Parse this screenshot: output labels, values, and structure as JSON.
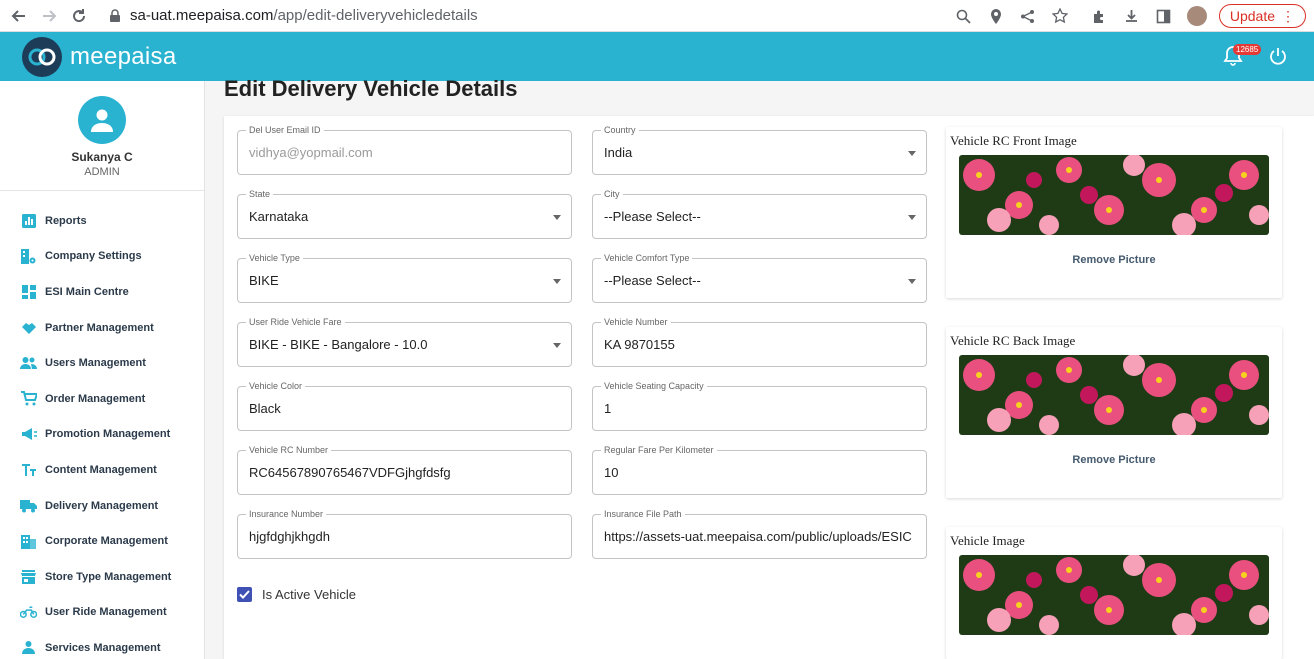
{
  "browser": {
    "url_host": "sa-uat.meepaisa.com",
    "url_path": "/app/edit-deliveryvehicledetails",
    "update_label": "Update"
  },
  "app": {
    "brand": "meepaisa",
    "notification_count": "12685"
  },
  "user": {
    "name": "Sukanya C",
    "role": "ADMIN"
  },
  "sidebar": {
    "items": [
      {
        "label": "Reports",
        "icon": "bar-chart-icon"
      },
      {
        "label": "Company Settings",
        "icon": "company-settings-icon"
      },
      {
        "label": "ESI Main Centre",
        "icon": "dashboard-icon"
      },
      {
        "label": "Partner Management",
        "icon": "handshake-icon"
      },
      {
        "label": "Users Management",
        "icon": "people-icon"
      },
      {
        "label": "Order Management",
        "icon": "cart-icon"
      },
      {
        "label": "Promotion Management",
        "icon": "megaphone-icon"
      },
      {
        "label": "Content Management",
        "icon": "text-fields-icon"
      },
      {
        "label": "Delivery Management",
        "icon": "truck-icon"
      },
      {
        "label": "Corporate Management",
        "icon": "building-icon"
      },
      {
        "label": "Store Type Management",
        "icon": "store-icon"
      },
      {
        "label": "User Ride Management",
        "icon": "motorcycle-icon"
      },
      {
        "label": "Services Management",
        "icon": "services-icon"
      }
    ]
  },
  "page": {
    "title": "Edit Delivery Vehicle Details"
  },
  "form": {
    "del_user_email": {
      "label": "Del User Email ID",
      "value": "vidhya@yopmail.com"
    },
    "country": {
      "label": "Country",
      "value": "India"
    },
    "state": {
      "label": "State",
      "value": "Karnataka"
    },
    "city": {
      "label": "City",
      "value": "--Please Select--"
    },
    "vehicle_type": {
      "label": "Vehicle Type",
      "value": "BIKE"
    },
    "vehicle_comfort_type": {
      "label": "Vehicle Comfort Type",
      "value": "--Please Select--"
    },
    "user_ride_vehicle_fare": {
      "label": "User Ride Vehicle Fare",
      "value": "BIKE - BIKE - Bangalore - 10.0"
    },
    "vehicle_number": {
      "label": "Vehicle Number",
      "value": "KA 9870155"
    },
    "vehicle_color": {
      "label": "Vehicle Color",
      "value": "Black"
    },
    "vehicle_seating_capacity": {
      "label": "Vehicle Seating Capacity",
      "value": "1"
    },
    "vehicle_rc_number": {
      "label": "Vehicle RC Number",
      "value": "RC64567890765467VDFGjhgfdsfg"
    },
    "regular_fare_per_km": {
      "label": "Regular Fare Per Kilometer",
      "value": "10"
    },
    "insurance_number": {
      "label": "Insurance Number",
      "value": "hjgfdghjkhgdh"
    },
    "insurance_file_path": {
      "label": "Insurance File Path",
      "value": "https://assets-uat.meepaisa.com/public/uploads/ESIC"
    },
    "is_active": {
      "label": "Is Active Vehicle",
      "checked": true
    }
  },
  "images": {
    "rc_front": {
      "title": "Vehicle RC Front Image",
      "remove_label": "Remove Picture"
    },
    "rc_back": {
      "title": "Vehicle RC Back Image",
      "remove_label": "Remove Picture"
    },
    "vehicle": {
      "title": "Vehicle Image"
    }
  },
  "colors": {
    "accent": "#29b3d1",
    "checkbox": "#3f51b5",
    "update": "#d93025"
  }
}
